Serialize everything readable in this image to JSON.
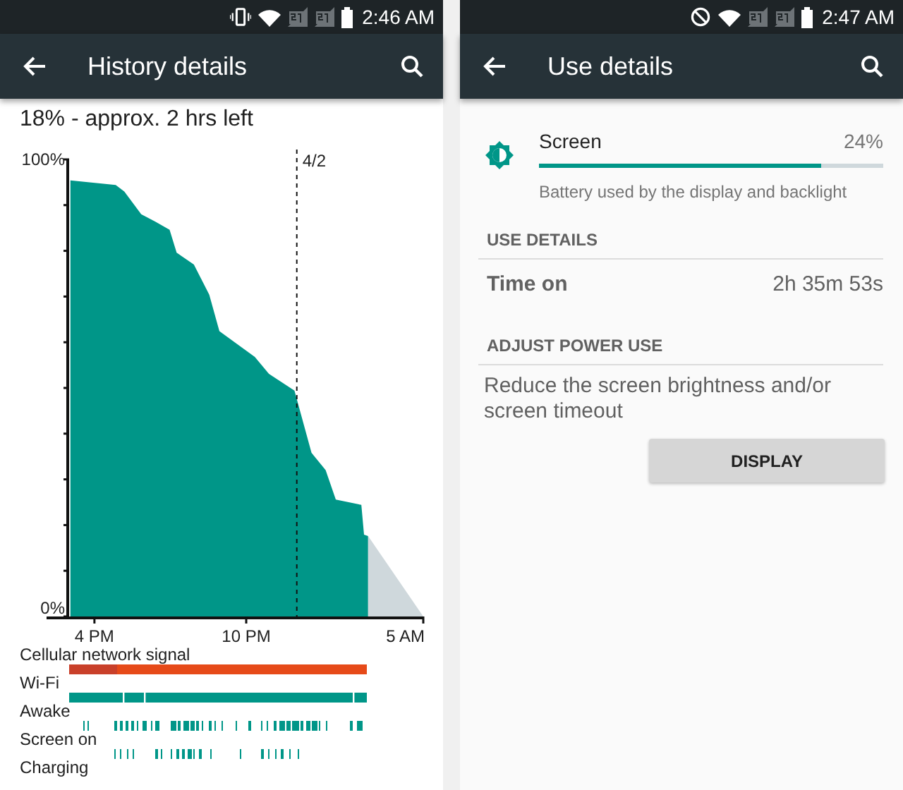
{
  "screens": [
    {
      "status_bar": {
        "time": "2:46 AM"
      },
      "toolbar": {
        "title": "History details"
      },
      "history": {
        "summary": "18% - approx. 2 hrs left",
        "chart": {
          "y_labels": [
            "100%",
            "0%"
          ],
          "x_labels": [
            "4 PM",
            "10 PM",
            "5 AM"
          ],
          "marker": "4/2"
        },
        "timelines": [
          {
            "kind": "signal",
            "label": "Cellular network signal"
          },
          {
            "kind": "wifi",
            "label": "Wi-Fi"
          },
          {
            "kind": "awake",
            "label": "Awake"
          },
          {
            "kind": "screen",
            "label": "Screen on"
          },
          {
            "kind": "charging",
            "label": "Charging"
          }
        ]
      }
    },
    {
      "status_bar": {
        "time": "2:47 AM"
      },
      "toolbar": {
        "title": "Use details"
      },
      "usage": {
        "name": "Screen",
        "percent": "24%",
        "level": 0.82,
        "description": "Battery used by the display and backlight",
        "sections": [
          {
            "header": "USE DETAILS",
            "kind": "row",
            "label": "Time on",
            "value": "2h 35m 53s"
          },
          {
            "header": "ADJUST POWER USE",
            "kind": "action",
            "text": "Reduce the screen brightness and/or screen timeout",
            "button": "DISPLAY"
          }
        ]
      }
    }
  ]
}
